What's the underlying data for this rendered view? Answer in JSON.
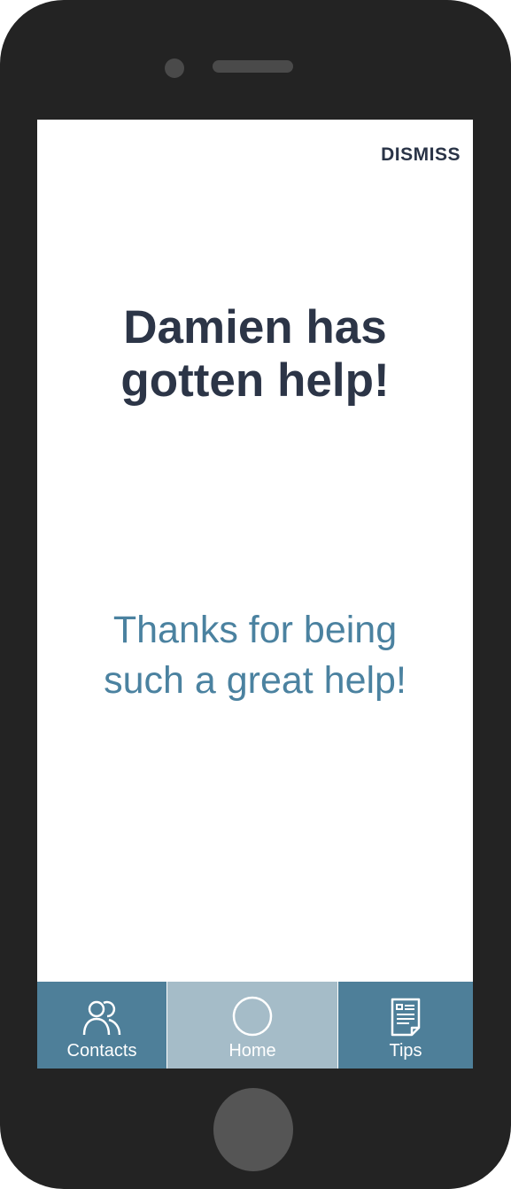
{
  "header": {
    "dismiss_label": "DISMISS"
  },
  "main": {
    "title_lines": [
      "Damien has",
      "gotten help!"
    ],
    "message_lines": [
      "Thanks for being",
      "such a great help!"
    ]
  },
  "tabs": {
    "contacts": {
      "label": "Contacts",
      "icon": "contacts-icon"
    },
    "home": {
      "label": "Home",
      "icon": "circle-icon",
      "selected": true
    },
    "tips": {
      "label": "Tips",
      "icon": "document-icon"
    }
  },
  "colors": {
    "title": "#2c3547",
    "message": "#4b82a0",
    "tab_active": "#a5bcc8",
    "tab_inactive": "#4e7f99",
    "phone_body": "#232323"
  }
}
